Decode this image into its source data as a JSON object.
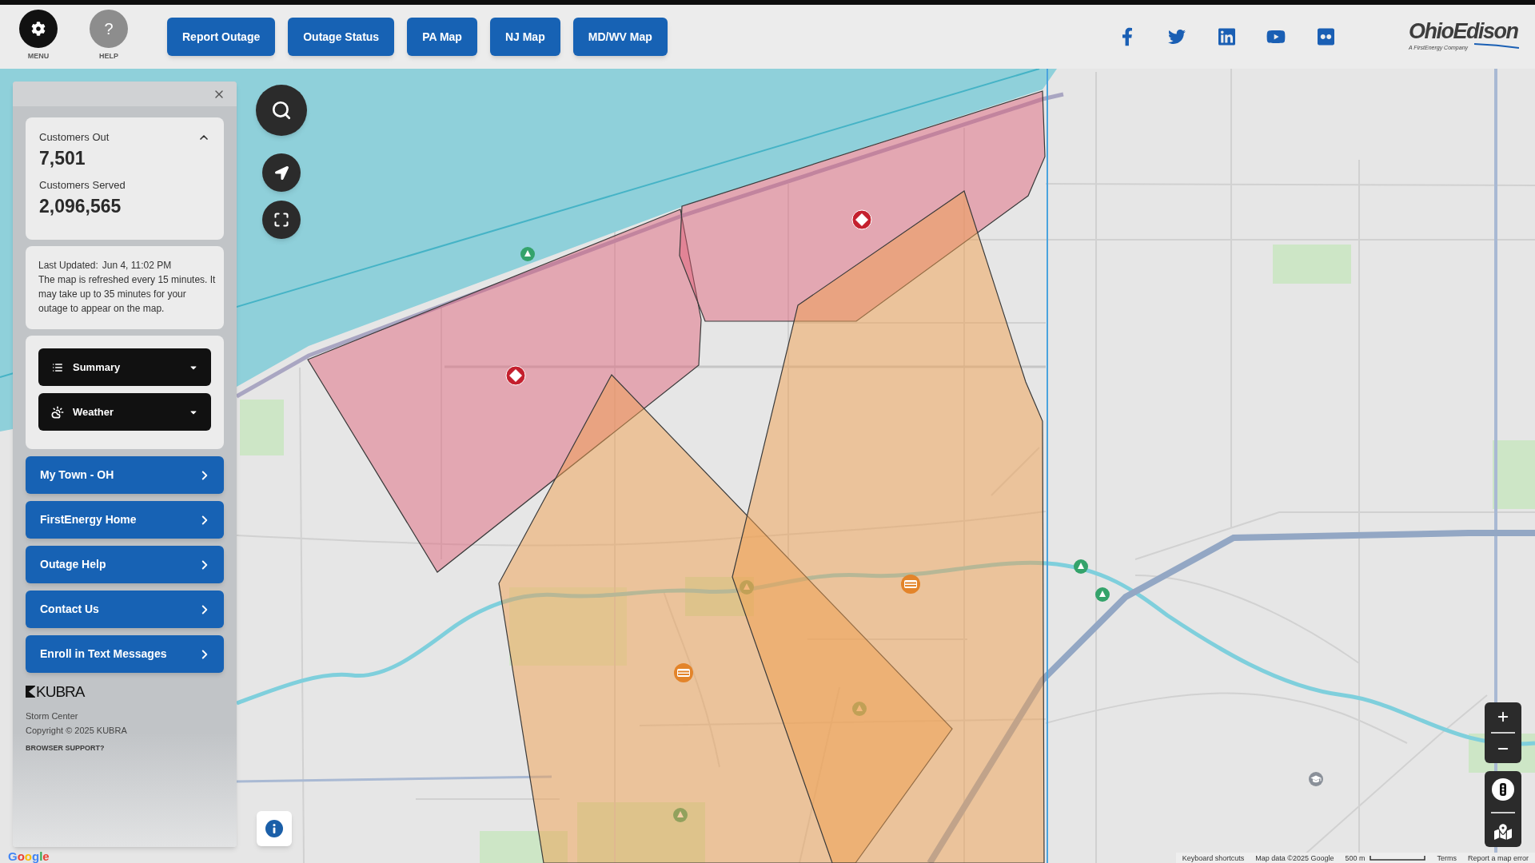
{
  "header": {
    "menu_button": {
      "label": "MENU"
    },
    "help_button": {
      "symbol": "?",
      "label": "HELP"
    },
    "nav_buttons": [
      "Report Outage",
      "Outage Status",
      "PA Map",
      "NJ Map",
      "MD/WV Map"
    ],
    "social_links": [
      {
        "kind": "facebook"
      },
      {
        "kind": "twitter"
      },
      {
        "kind": "linkedin"
      },
      {
        "kind": "youtube"
      },
      {
        "kind": "flickr"
      }
    ],
    "logo": {
      "wordmark": "OhioEdison",
      "tagline": "A FirstEnergy Company"
    }
  },
  "sidebar": {
    "stats": {
      "expanded": true,
      "items": [
        {
          "label": "Customers Out",
          "value": "7,501"
        },
        {
          "label": "Customers Served",
          "value": "2,096,565"
        }
      ]
    },
    "update_info": {
      "last_updated_label": "Last Updated:",
      "last_updated_value": "Jun 4, 11:02 PM",
      "note": "The map is refreshed every 15 minutes. It may take up to 35 minutes for your outage to appear on the map."
    },
    "dropdowns": [
      {
        "kind": "list",
        "label": "Summary",
        "expanded": false
      },
      {
        "kind": "weather",
        "label": "Weather",
        "expanded": false
      }
    ],
    "links": [
      "My Town - OH",
      "FirstEnergy Home",
      "Outage Help",
      "Contact Us",
      "Enroll in Text Messages"
    ],
    "footer": {
      "brand": "KUBRA",
      "product": "Storm Center",
      "copyright": "Copyright © 2025 KUBRA",
      "support_link": "BROWSER SUPPORT?"
    }
  },
  "map": {
    "markers": [
      {
        "kind": "diamond"
      },
      {
        "kind": "diamond"
      },
      {
        "kind": "stripes"
      },
      {
        "kind": "stripes"
      }
    ],
    "attribution": {
      "logo": "Google",
      "items": [
        {
          "kind": "link",
          "text": "Keyboard shortcuts"
        },
        {
          "kind": "text",
          "text": "Map data ©2025 Google"
        },
        {
          "kind": "scale",
          "text": "500 m"
        },
        {
          "kind": "link",
          "text": "Terms"
        },
        {
          "kind": "link",
          "text": "Report a map error"
        }
      ]
    }
  }
}
